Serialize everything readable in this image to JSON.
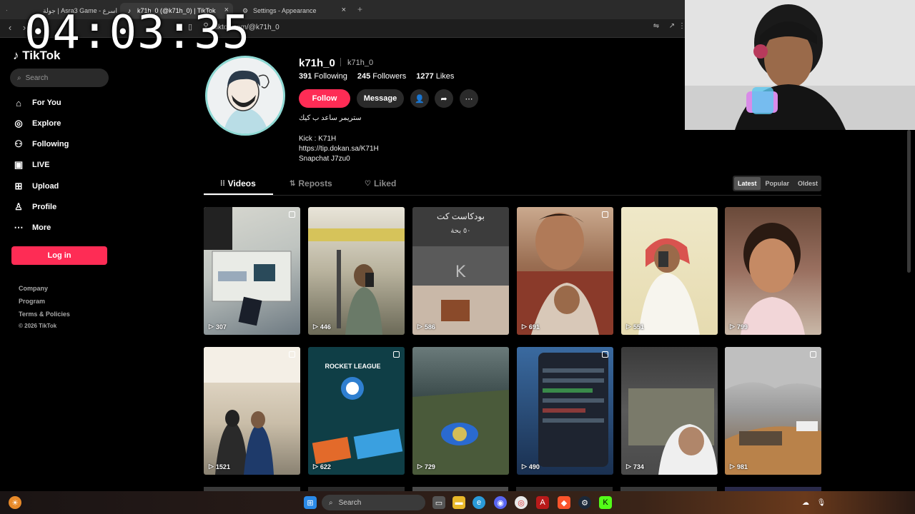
{
  "browser": {
    "tabs": [
      {
        "label": "جولة | Asra3 Game - جولة اسرع"
      },
      {
        "label": "k71h_0 (@k71h_0) | TikTok"
      },
      {
        "label": "Settings - Appearance"
      }
    ],
    "url": "tiktok.com/@k71h_0",
    "new_tab": "+"
  },
  "overlay": {
    "timer": "04:03:35"
  },
  "sidebar": {
    "logo": "TikTok",
    "search_placeholder": "Search",
    "items": [
      {
        "label": "For You",
        "icon": "home-icon"
      },
      {
        "label": "Explore",
        "icon": "compass-icon"
      },
      {
        "label": "Following",
        "icon": "following-icon"
      },
      {
        "label": "LIVE",
        "icon": "live-icon"
      },
      {
        "label": "Upload",
        "icon": "upload-icon"
      },
      {
        "label": "Profile",
        "icon": "profile-icon"
      },
      {
        "label": "More",
        "icon": "more-icon"
      }
    ],
    "login": "Log in",
    "footer": [
      "Company",
      "Program",
      "Terms & Policies",
      "© 2026 TikTok"
    ]
  },
  "profile": {
    "username": "k71h_0",
    "handle": "k71h_0",
    "following_count": "391",
    "following_label": "Following",
    "followers_count": "245",
    "followers_label": "Followers",
    "likes_count": "1277",
    "likes_label": "Likes",
    "follow": "Follow",
    "message": "Message",
    "bio": [
      "ستريمر ساعد ب كيك",
      "Kick : K71H",
      "https://tip.dokan.sa/K71H",
      "Snapchat J7zu0"
    ]
  },
  "tabs": {
    "videos": "Videos",
    "reposts": "Reposts",
    "liked": "Liked"
  },
  "sort": {
    "latest": "Latest",
    "popular": "Popular",
    "oldest": "Oldest",
    "selected": "Latest"
  },
  "videos": [
    {
      "views": "307",
      "multi": true
    },
    {
      "views": "446",
      "multi": false
    },
    {
      "views": "586",
      "multi": false
    },
    {
      "views": "691",
      "multi": true
    },
    {
      "views": "551",
      "multi": false
    },
    {
      "views": "799",
      "multi": false
    },
    {
      "views": "1521",
      "multi": true
    },
    {
      "views": "622",
      "multi": true
    },
    {
      "views": "729",
      "multi": false
    },
    {
      "views": "490",
      "multi": true
    },
    {
      "views": "734",
      "multi": false
    },
    {
      "views": "981",
      "multi": true
    }
  ],
  "video_text": {
    "v3_title": "بودكاست كت",
    "v3_sub": "٥٠ بحة",
    "v8_brand": "ROCKET LEAGUE"
  },
  "taskbar": {
    "search": "Search"
  },
  "colors": {
    "accent": "#fe2c55",
    "background": "#000000",
    "surface": "#2a2a2a"
  }
}
